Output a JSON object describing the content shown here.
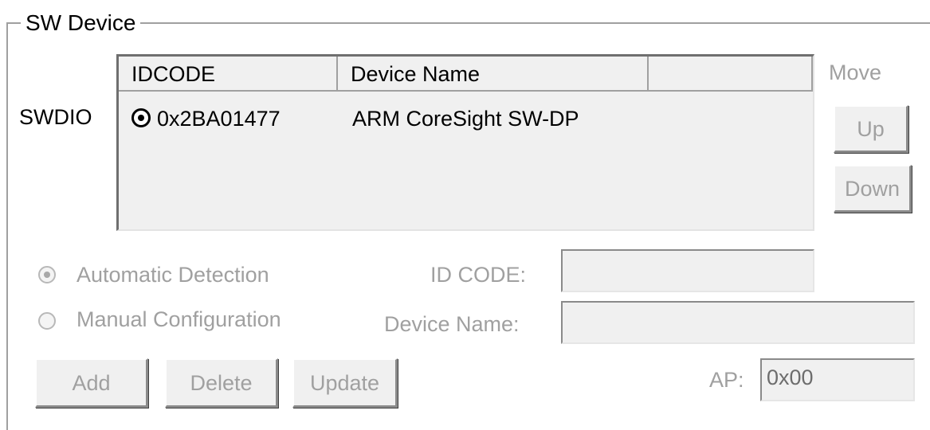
{
  "group": {
    "title": "SW Device"
  },
  "swdio_label": "SWDIO",
  "move": {
    "label": "Move",
    "up_label": "Up",
    "down_label": "Down"
  },
  "device_list": {
    "columns": [
      "IDCODE",
      "Device Name",
      ""
    ],
    "rows": [
      {
        "idcode": "0x2BA01477",
        "device_name": "ARM CoreSight SW-DP",
        "selected": true
      }
    ]
  },
  "detection": {
    "automatic_label": "Automatic Detection",
    "manual_label": "Manual Configuration",
    "automatic_selected": true,
    "enabled": false
  },
  "fields": {
    "id_code_label": "ID CODE:",
    "id_code_value": "",
    "device_name_label": "Device Name:",
    "device_name_value": "",
    "ap_label": "AP:",
    "ap_value": "0x00"
  },
  "actions": {
    "add_label": "Add",
    "delete_label": "Delete",
    "update_label": "Update"
  },
  "colors": {
    "disabled_text": "#a0a0a0",
    "panel_bg": "#f0f0f0"
  }
}
